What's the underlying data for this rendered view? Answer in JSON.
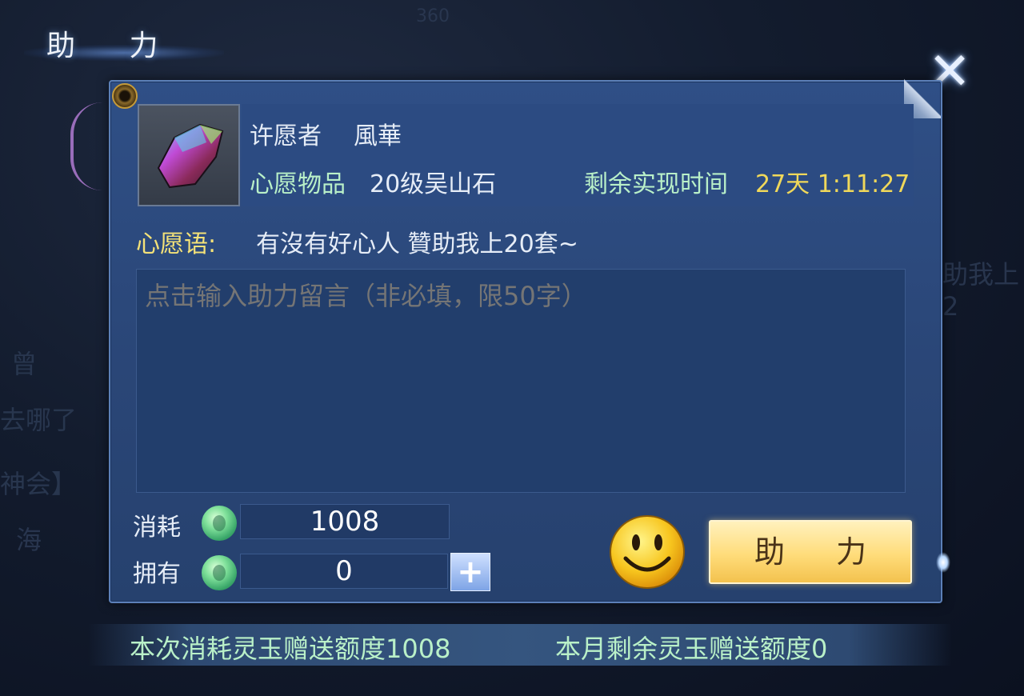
{
  "title": "助 力",
  "close_icon": "close-icon",
  "background_hints": [
    "360",
    "助我上2",
    "曾",
    "去哪了",
    "神会】",
    "海"
  ],
  "wisher": {
    "label": "许愿者",
    "name": "風華"
  },
  "wish_item": {
    "label": "心愿物品",
    "value": "20级吴山石",
    "icon": "gem-icon"
  },
  "remaining_time": {
    "label": "剩余实现时间",
    "value": "27天 1:11:27"
  },
  "wish_words": {
    "label": "心愿语:",
    "text": "有沒有好心人 贊助我上20套~"
  },
  "message_input": {
    "placeholder": "点击输入助力留言（非必填，限50字）",
    "value": ""
  },
  "cost": {
    "label": "消耗",
    "value": "1008",
    "currency_icon": "jade-icon"
  },
  "owned": {
    "label": "拥有",
    "value": "0",
    "add_label": "+"
  },
  "emoji_icon": "smiley-icon",
  "help_button": {
    "label": "助 力"
  },
  "footer": {
    "gift_this_time": "本次消耗灵玉赠送额度1008",
    "gift_month_remaining": "本月剩余灵玉赠送额度0"
  },
  "colors": {
    "panel": "#2f4f86",
    "highlight": "#f0d85a",
    "green_text": "#b9f0c8",
    "button": "#ffdc7a"
  }
}
